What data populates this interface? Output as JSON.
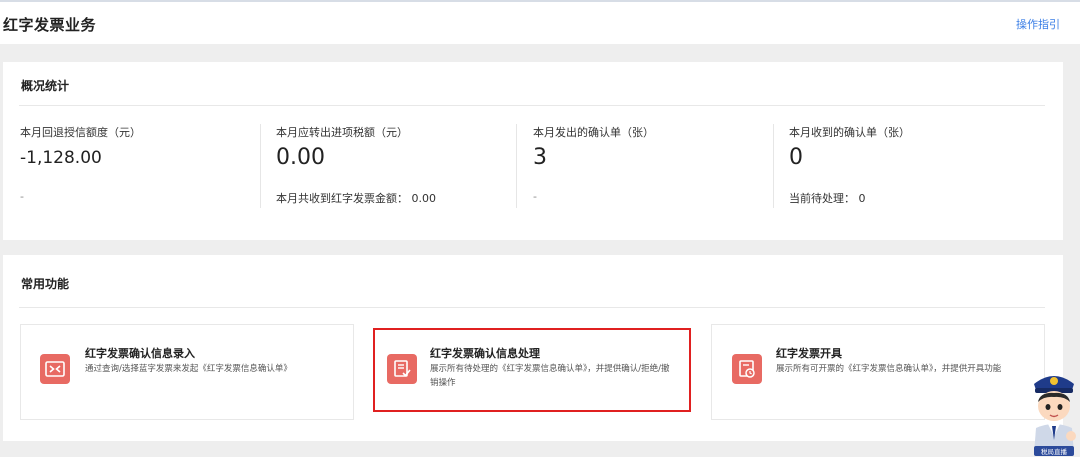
{
  "header": {
    "title": "红字发票业务",
    "guide_link": "操作指引"
  },
  "overview": {
    "title": "概况统计",
    "stats": [
      {
        "label": "本月回退授信额度（元）",
        "value": "-1,128.00",
        "sub": "-"
      },
      {
        "label": "本月应转出进项税额（元）",
        "value": "0.00",
        "sub": "本月共收到红字发票金额： 0.00"
      },
      {
        "label": "本月发出的确认单（张）",
        "value": "3",
        "sub": "-"
      },
      {
        "label": "本月收到的确认单（张）",
        "value": "0",
        "sub": "当前待处理： 0"
      }
    ]
  },
  "functions": {
    "title": "常用功能",
    "cards": [
      {
        "title": "红字发票确认信息录入",
        "desc": "通过查询/选择蓝字发票来发起《红字发票信息确认单》",
        "icon": "exchange-icon"
      },
      {
        "title": "红字发票确认信息处理",
        "desc_line1": "展示所有待处理的《红字发票信息确认单》，并提供确认/拒绝/撤",
        "desc_line2": "销操作",
        "icon": "document-check-icon"
      },
      {
        "title": "红字发票开具",
        "desc": "展示所有可开票的《红字发票信息确认单》，并提供开具功能",
        "icon": "invoice-clock-icon"
      }
    ]
  },
  "mascot": {
    "caption": "税局直播"
  },
  "colors": {
    "accent_blue": "#3a7ee6",
    "icon_red": "#e86a63",
    "selected_border": "#e02020",
    "background": "#eeeeee"
  }
}
